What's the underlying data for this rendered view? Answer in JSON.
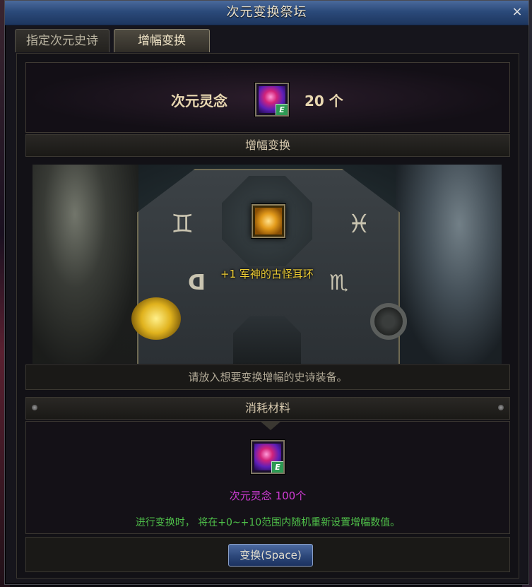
{
  "window": {
    "title": "次元变换祭坛",
    "close_glyph": "×"
  },
  "tabs": [
    {
      "label": "指定次元史诗",
      "active": false
    },
    {
      "label": "增幅变换",
      "active": true
    }
  ],
  "resource": {
    "label": "次元灵念",
    "icon": "dimension-spirit-gem-icon",
    "badge": "E",
    "count": "20 个"
  },
  "section_altar": {
    "title": "增幅变换"
  },
  "altar": {
    "item_name": "+1 军神的古怪耳环",
    "item_icon": "earring-icon",
    "hint": "请放入想要变换增幅的史诗装备。"
  },
  "section_materials": {
    "title": "消耗材料"
  },
  "materials": {
    "icon": "dimension-spirit-gem-icon",
    "badge": "E",
    "label": "次元灵念 100个",
    "note": "进行变换时， 将在+0~+10范围内随机重新设置增幅数值。"
  },
  "action": {
    "button_label": "变换(Space)"
  },
  "colors": {
    "title_bar": "#2b4a7a",
    "item_name": "#f0cf36",
    "material_label": "#d13cd6",
    "note": "#4fc14a"
  }
}
